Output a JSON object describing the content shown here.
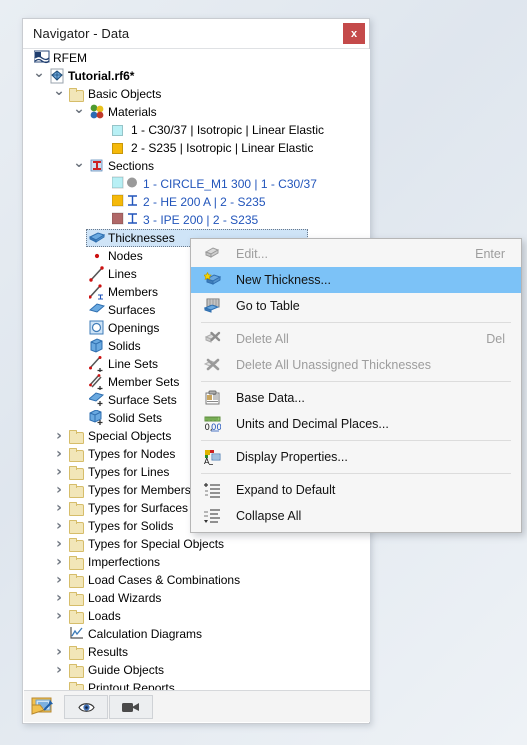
{
  "window": {
    "title": "Navigator - Data",
    "close_label": "x"
  },
  "tree": {
    "items": [
      {
        "label": "RFEM",
        "indent": 0,
        "arrow": "none",
        "icon": "rfem-logo-icon",
        "bold": false,
        "blue": false
      },
      {
        "label": "Tutorial.rf6*",
        "indent": 1,
        "arrow": "down",
        "icon": "model-icon",
        "bold": true,
        "blue": false
      },
      {
        "label": "Basic Objects",
        "indent": 2,
        "arrow": "down",
        "icon": "folder-icon",
        "bold": false,
        "blue": false
      },
      {
        "label": "Materials",
        "indent": 3,
        "arrow": "down",
        "icon": "materials-icon",
        "bold": false,
        "blue": false
      },
      {
        "label": "1 - C30/37 | Isotropic | Linear Elastic",
        "indent": 4,
        "arrow": "none",
        "icon": "swatch-cyan",
        "bold": false,
        "blue": false
      },
      {
        "label": "2 - S235 | Isotropic | Linear Elastic",
        "indent": 4,
        "arrow": "none",
        "icon": "swatch-amber",
        "bold": false,
        "blue": false
      },
      {
        "label": "Sections",
        "indent": 3,
        "arrow": "down",
        "icon": "sections-icon",
        "bold": false,
        "blue": false
      },
      {
        "label": "1 - CIRCLE_M1 300 | 1 - C30/37",
        "indent": 4,
        "arrow": "none",
        "icon": "swatch-cyan-circle",
        "bold": false,
        "blue": true
      },
      {
        "label": "2 - HE 200 A | 2 - S235",
        "indent": 4,
        "arrow": "none",
        "icon": "swatch-amber-i",
        "bold": false,
        "blue": true
      },
      {
        "label": "3 - IPE 200 | 2 - S235",
        "indent": 4,
        "arrow": "none",
        "icon": "swatch-rose-i",
        "bold": false,
        "blue": true
      },
      {
        "label": "Thicknesses",
        "indent": 3,
        "arrow": "none",
        "icon": "thickness-icon",
        "bold": false,
        "blue": false,
        "selected": true
      },
      {
        "label": "Nodes",
        "indent": 3,
        "arrow": "none",
        "icon": "node-icon",
        "bold": false,
        "blue": false
      },
      {
        "label": "Lines",
        "indent": 3,
        "arrow": "none",
        "icon": "line-icon",
        "bold": false,
        "blue": false
      },
      {
        "label": "Members",
        "indent": 3,
        "arrow": "none",
        "icon": "member-icon",
        "bold": false,
        "blue": false
      },
      {
        "label": "Surfaces",
        "indent": 3,
        "arrow": "none",
        "icon": "surface-icon",
        "bold": false,
        "blue": false
      },
      {
        "label": "Openings",
        "indent": 3,
        "arrow": "none",
        "icon": "opening-icon",
        "bold": false,
        "blue": false
      },
      {
        "label": "Solids",
        "indent": 3,
        "arrow": "none",
        "icon": "solid-icon",
        "bold": false,
        "blue": false
      },
      {
        "label": "Line Sets",
        "indent": 3,
        "arrow": "none",
        "icon": "line-set-icon",
        "bold": false,
        "blue": false
      },
      {
        "label": "Member Sets",
        "indent": 3,
        "arrow": "none",
        "icon": "member-set-icon",
        "bold": false,
        "blue": false
      },
      {
        "label": "Surface Sets",
        "indent": 3,
        "arrow": "none",
        "icon": "surface-set-icon",
        "bold": false,
        "blue": false
      },
      {
        "label": "Solid Sets",
        "indent": 3,
        "arrow": "none",
        "icon": "solid-set-icon",
        "bold": false,
        "blue": false
      },
      {
        "label": "Special Objects",
        "indent": 2,
        "arrow": "right",
        "icon": "folder-icon",
        "bold": false,
        "blue": false
      },
      {
        "label": "Types for Nodes",
        "indent": 2,
        "arrow": "right",
        "icon": "folder-icon",
        "bold": false,
        "blue": false
      },
      {
        "label": "Types for Lines",
        "indent": 2,
        "arrow": "right",
        "icon": "folder-icon",
        "bold": false,
        "blue": false
      },
      {
        "label": "Types for Members",
        "indent": 2,
        "arrow": "right",
        "icon": "folder-icon",
        "bold": false,
        "blue": false
      },
      {
        "label": "Types for Surfaces",
        "indent": 2,
        "arrow": "right",
        "icon": "folder-icon",
        "bold": false,
        "blue": false
      },
      {
        "label": "Types for Solids",
        "indent": 2,
        "arrow": "right",
        "icon": "folder-icon",
        "bold": false,
        "blue": false
      },
      {
        "label": "Types for Special Objects",
        "indent": 2,
        "arrow": "right",
        "icon": "folder-icon",
        "bold": false,
        "blue": false
      },
      {
        "label": "Imperfections",
        "indent": 2,
        "arrow": "right",
        "icon": "folder-icon",
        "bold": false,
        "blue": false
      },
      {
        "label": "Load Cases & Combinations",
        "indent": 2,
        "arrow": "right",
        "icon": "folder-icon",
        "bold": false,
        "blue": false
      },
      {
        "label": "Load Wizards",
        "indent": 2,
        "arrow": "right",
        "icon": "folder-icon",
        "bold": false,
        "blue": false
      },
      {
        "label": "Loads",
        "indent": 2,
        "arrow": "right",
        "icon": "folder-icon",
        "bold": false,
        "blue": false
      },
      {
        "label": "Calculation Diagrams",
        "indent": 2,
        "arrow": "none",
        "icon": "diagram-icon",
        "bold": false,
        "blue": false
      },
      {
        "label": "Results",
        "indent": 2,
        "arrow": "right",
        "icon": "folder-icon",
        "bold": false,
        "blue": false
      },
      {
        "label": "Guide Objects",
        "indent": 2,
        "arrow": "right",
        "icon": "folder-icon",
        "bold": false,
        "blue": false
      },
      {
        "label": "Printout Reports",
        "indent": 2,
        "arrow": "none",
        "icon": "folder-icon",
        "bold": false,
        "blue": false
      }
    ]
  },
  "context_menu": {
    "items": [
      {
        "label": "Edit...",
        "accel": "Enter",
        "icon": "edit-icon",
        "state": "disabled"
      },
      {
        "label": "New Thickness...",
        "accel": "",
        "icon": "new-thickness-icon",
        "state": "highlighted"
      },
      {
        "label": "Go to Table",
        "accel": "",
        "icon": "go-to-table-icon",
        "state": "normal"
      },
      {
        "type": "separator"
      },
      {
        "label": "Delete All",
        "accel": "Del",
        "icon": "delete-all-icon",
        "state": "disabled"
      },
      {
        "label": "Delete All Unassigned Thicknesses",
        "accel": "",
        "icon": "delete-unassigned-icon",
        "state": "disabled"
      },
      {
        "type": "separator"
      },
      {
        "label": "Base Data...",
        "accel": "",
        "icon": "base-data-icon",
        "state": "normal"
      },
      {
        "label": "Units and Decimal Places...",
        "accel": "",
        "icon": "units-decimal-icon",
        "state": "normal"
      },
      {
        "type": "separator"
      },
      {
        "label": "Display Properties...",
        "accel": "",
        "icon": "display-properties-icon",
        "state": "normal"
      },
      {
        "type": "separator"
      },
      {
        "label": "Expand to Default",
        "accel": "",
        "icon": "expand-icon",
        "state": "normal"
      },
      {
        "label": "Collapse All",
        "accel": "",
        "icon": "collapse-icon",
        "state": "normal"
      }
    ]
  },
  "bottom_bar": {
    "tabs": [
      {
        "icon": "navigator-data-icon"
      },
      {
        "icon": "eye-icon"
      },
      {
        "icon": "video-camera-icon"
      }
    ]
  },
  "colors": {
    "accent_highlight": "#7cc2f7",
    "selection": "#cfe4f7",
    "close_button": "#c44a4a",
    "link_text": "#2255bb",
    "material_c30": "#b8f0f5",
    "material_s235": "#f5b90a",
    "section_ipe": "#b06868",
    "folder": "#f2e6b8"
  }
}
